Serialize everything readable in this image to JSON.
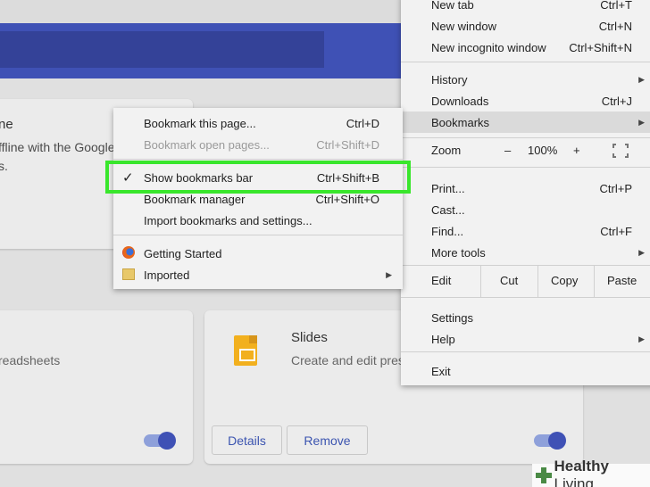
{
  "background": {
    "card_a_title": "ne",
    "card_a_text": "ffline with the Google",
    "card_a_text2": "s.",
    "card_b_text": "readsheets",
    "slides": {
      "title": "Slides",
      "description": "Create and edit pres",
      "details_label": "Details",
      "remove_label": "Remove"
    }
  },
  "chrome_menu": {
    "items_top": [
      {
        "label": "New tab",
        "shortcut": "Ctrl+T"
      },
      {
        "label": "New window",
        "shortcut": "Ctrl+N"
      },
      {
        "label": "New incognito window",
        "shortcut": "Ctrl+Shift+N"
      }
    ],
    "history": "History",
    "downloads": {
      "label": "Downloads",
      "shortcut": "Ctrl+J"
    },
    "bookmarks": "Bookmarks",
    "zoom": {
      "label": "Zoom",
      "minus": "–",
      "value": "100%",
      "plus": "+"
    },
    "print": {
      "label": "Print...",
      "shortcut": "Ctrl+P"
    },
    "cast": "Cast...",
    "find": {
      "label": "Find...",
      "shortcut": "Ctrl+F"
    },
    "more_tools": "More tools",
    "edit": {
      "label": "Edit",
      "cut": "Cut",
      "copy": "Copy",
      "paste": "Paste"
    },
    "settings": "Settings",
    "help": "Help",
    "exit": "Exit"
  },
  "bookmarks_menu": {
    "bookmark_page": {
      "label": "Bookmark this page...",
      "shortcut": "Ctrl+D"
    },
    "bookmark_open": {
      "label": "Bookmark open pages...",
      "shortcut": "Ctrl+Shift+D"
    },
    "show_bar": {
      "label": "Show bookmarks bar",
      "shortcut": "Ctrl+Shift+B",
      "checked": true
    },
    "manager": {
      "label": "Bookmark manager",
      "shortcut": "Ctrl+Shift+O"
    },
    "import": "Import bookmarks and settings...",
    "getting_started": "Getting Started",
    "imported": "Imported"
  },
  "watermark": {
    "brand": "Healthy",
    "suffix": " Living"
  },
  "colors": {
    "highlight": "#39e62c",
    "header_blue": "#3f51b5",
    "link_blue": "#3b54b0"
  }
}
